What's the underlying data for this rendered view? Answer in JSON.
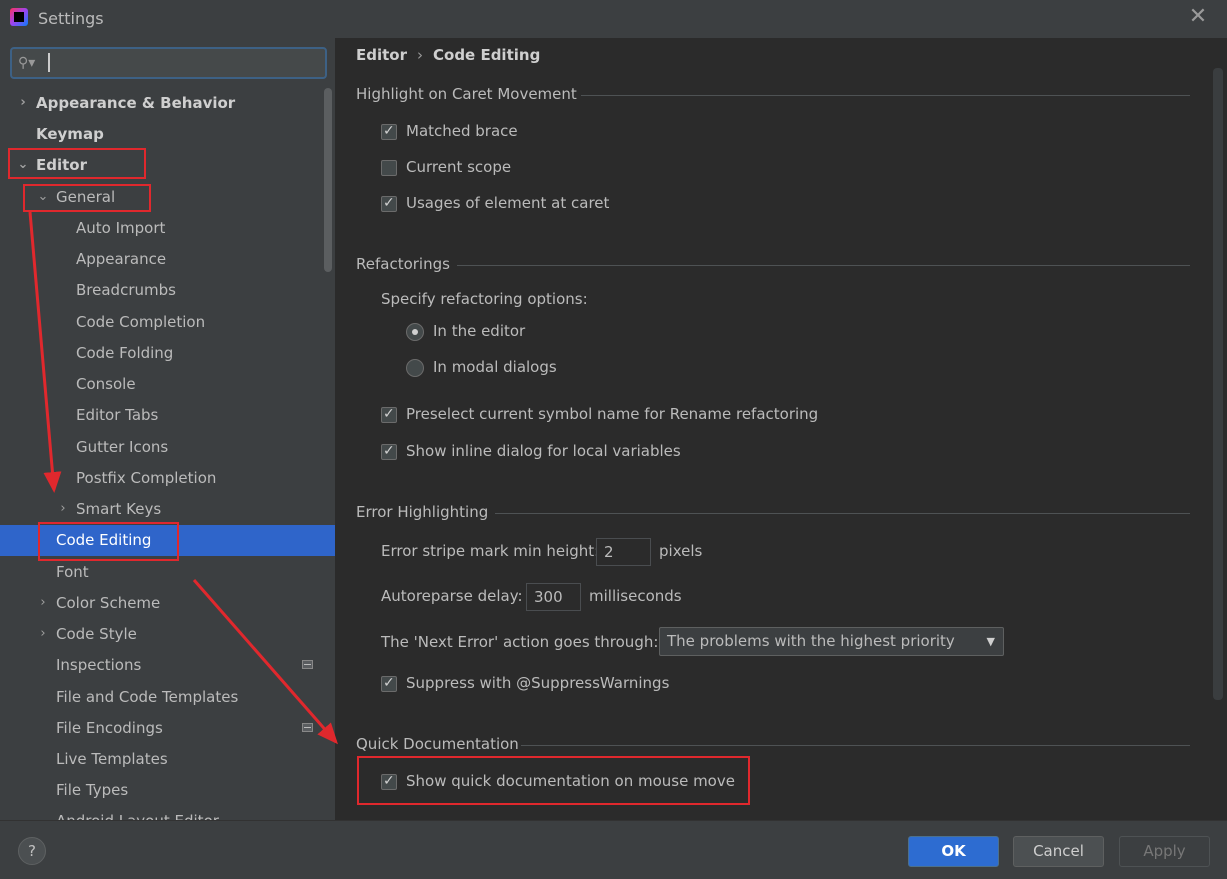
{
  "window": {
    "title": "Settings",
    "close_icon": "close-icon"
  },
  "search": {
    "value": "",
    "placeholder": ""
  },
  "sidebar": {
    "items": [
      {
        "label": "Appearance & Behavior",
        "arrow": "›",
        "bold": true
      },
      {
        "label": "Keymap",
        "arrow": "",
        "bold": true
      },
      {
        "label": "Editor",
        "arrow": "⌄",
        "bold": true
      },
      {
        "label": "General",
        "arrow": "⌄"
      },
      {
        "label": "Auto Import"
      },
      {
        "label": "Appearance"
      },
      {
        "label": "Breadcrumbs"
      },
      {
        "label": "Code Completion"
      },
      {
        "label": "Code Folding"
      },
      {
        "label": "Console"
      },
      {
        "label": "Editor Tabs"
      },
      {
        "label": "Gutter Icons"
      },
      {
        "label": "Postfix Completion"
      },
      {
        "label": "Smart Keys",
        "arrow": "›"
      },
      {
        "label": "Code Editing",
        "selected": true
      },
      {
        "label": "Font"
      },
      {
        "label": "Color Scheme",
        "arrow": "›"
      },
      {
        "label": "Code Style",
        "arrow": "›"
      },
      {
        "label": "Inspections"
      },
      {
        "label": "File and Code Templates"
      },
      {
        "label": "File Encodings"
      },
      {
        "label": "Live Templates"
      },
      {
        "label": "File Types"
      },
      {
        "label": "Android Layout Editor"
      }
    ]
  },
  "breadcrumb": {
    "parent": "Editor",
    "separator": "›",
    "current": "Code Editing"
  },
  "sections": {
    "caret": {
      "title": "Highlight on Caret Movement",
      "options": [
        {
          "label": "Matched brace",
          "checked": true
        },
        {
          "label": "Current scope",
          "checked": false
        },
        {
          "label": "Usages of element at caret",
          "checked": true
        }
      ]
    },
    "refactorings": {
      "title": "Refactorings",
      "specify_label": "Specify refactoring options:",
      "radio_editor": "In the editor",
      "radio_modal": "In modal dialogs",
      "preselect": "Preselect current symbol name for Rename refactoring",
      "inline_dialog": "Show inline dialog for local variables"
    },
    "errors": {
      "title": "Error Highlighting",
      "stripe_label": "Error stripe mark min height:",
      "stripe_value": "2",
      "stripe_unit": "pixels",
      "reparse_label": "Autoreparse delay:",
      "reparse_value": "300",
      "reparse_unit": "milliseconds",
      "next_error_label": "The 'Next Error' action goes through:",
      "next_error_value": "The problems with the highest priority",
      "suppress": "Suppress with @SuppressWarnings"
    },
    "quickdoc": {
      "title": "Quick Documentation",
      "show_on_mouse": "Show quick documentation on mouse move"
    }
  },
  "footer": {
    "help": "?",
    "ok": "OK",
    "cancel": "Cancel",
    "apply": "Apply"
  },
  "colors": {
    "accent": "#2f65ca",
    "highlight_red": "#e0282d",
    "background": "#2b2b2b",
    "panel": "#3c3f41"
  }
}
